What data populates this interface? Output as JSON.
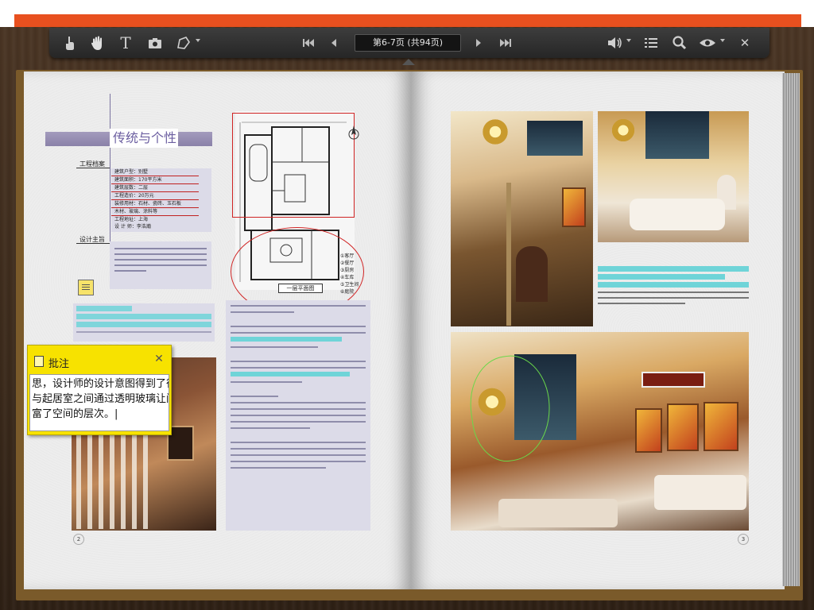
{
  "toolbar": {
    "page_indicator": "第6-7页 (共94页)",
    "icons": [
      "pointer-icon",
      "hand-icon",
      "text-icon",
      "camera-icon",
      "shape-icon",
      "first-page-icon",
      "prev-page-icon",
      "next-page-icon",
      "last-page-icon",
      "sound-icon",
      "list-icon",
      "search-icon",
      "view-icon",
      "close-icon"
    ]
  },
  "left_page": {
    "title": "传统与个性",
    "label_engineering": "工程档案",
    "label_design": "设计主旨",
    "spec_lines": [
      "建筑户型：别墅",
      "建筑面积：170平方米",
      "建筑层数：二层",
      "工程造价：20万元",
      "装修用材：石材、瓷砖、玉石板",
      "木材、玻璃、涂料等",
      "工程地址：上海",
      "设 计 师：李浩瀚"
    ],
    "floorplan_label": "一层平面图",
    "legend": [
      "①客厅",
      "②餐厅",
      "③厨房",
      "④车库",
      "⑤卫生间",
      "⑥庭院"
    ],
    "page_number": "2"
  },
  "annotation": {
    "title": "批注",
    "close_symbol": "✕",
    "lines": [
      "思，设计师的设计意图得到了很",
      "与起居室之间通过透明玻璃让间",
      "富了空间的层次。|"
    ]
  },
  "right_page": {
    "page_number": "3"
  },
  "colors": {
    "accent_orange": "#e8501f",
    "title_purple": "#8a81a8",
    "highlight_cyan": "#6fd4d8",
    "annotation_yellow": "#f7e200",
    "markup_red": "#d02424",
    "markup_green": "#6ad84a"
  }
}
